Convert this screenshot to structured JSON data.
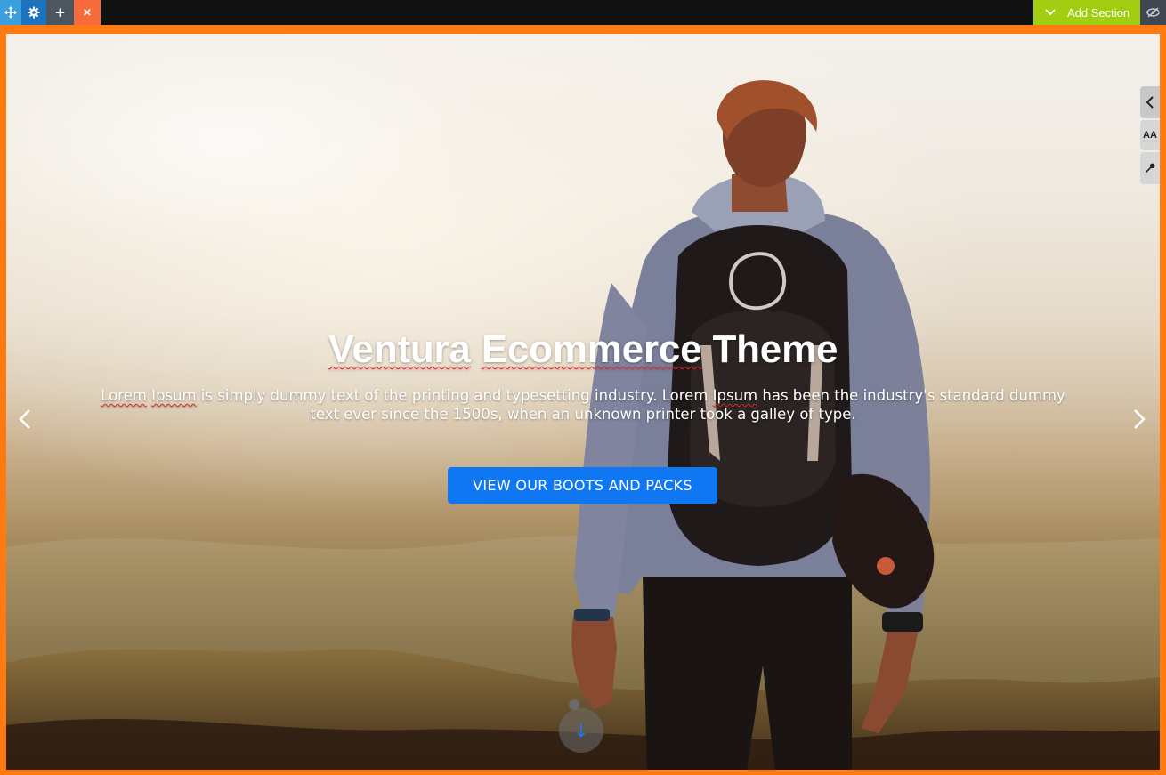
{
  "topbar": {
    "move_icon": "move-arrows-icon",
    "settings_icon": "gear-icon",
    "add_icon": "plus-icon",
    "add_glyph": "+",
    "close_icon": "close-icon",
    "close_glyph": "×",
    "add_section_label": "Add Section",
    "visibility_icon": "eye-slash-icon"
  },
  "side_tools": {
    "collapse_icon": "chevron-left-icon",
    "typography_label": "AA",
    "tools_icon": "wrench-icon"
  },
  "hero": {
    "title_part1": "Ventura",
    "title_part2": "Ecommerce",
    "title_part3": "Theme",
    "desc_w1": "Lorem",
    "desc_w2": "Ipsum",
    "desc_mid": " is simply dummy text of the printing and typesetting industry. Lorem ",
    "desc_w3": "Ipsum",
    "desc_end": " has been the industry's standard dummy text ever since the 1500s, when an unknown printer took a galley of type.",
    "button_label": "VIEW OUR BOOTS AND PACKS",
    "scroll_glyph": "↓"
  },
  "slider": {
    "active_slide": 1,
    "slide_count": 2
  },
  "colors": {
    "frame": "#ff7a10",
    "add_section": "#a2cd10",
    "cta": "#1077f2"
  }
}
